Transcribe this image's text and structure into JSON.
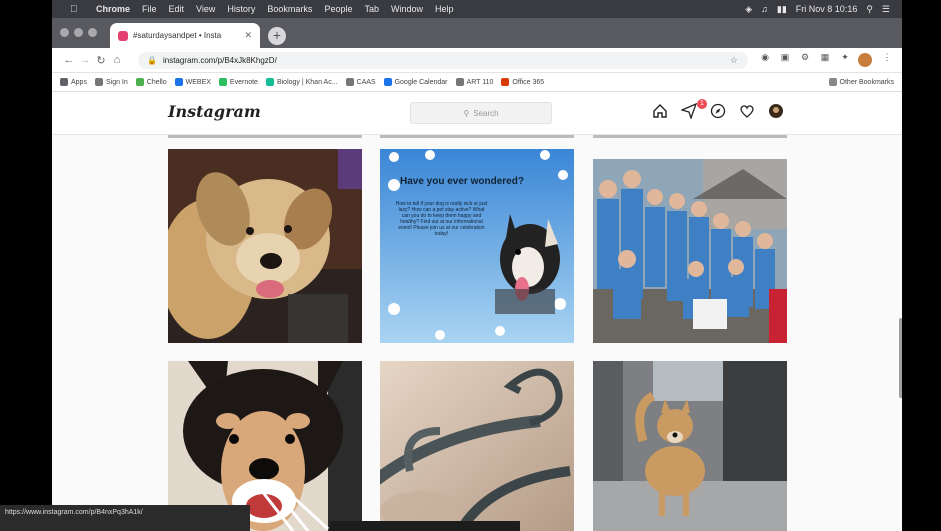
{
  "menubar": {
    "app": "Chrome",
    "items": [
      "File",
      "Edit",
      "View",
      "History",
      "Bookmarks",
      "People",
      "Tab",
      "Window",
      "Help"
    ],
    "clock": "Fri Nov 8 10:16"
  },
  "tab": {
    "title": "#saturdaysandpet • Insta"
  },
  "address": {
    "url": "instagram.com/p/B4xJk8KhgzD/"
  },
  "bookmarks": [
    {
      "label": "Apps",
      "color": "#5f6368"
    },
    {
      "label": "Sign In",
      "color": "#777777"
    },
    {
      "label": "Chello",
      "color": "#4caf50"
    },
    {
      "label": "WEBEX",
      "color": "#1a73e8"
    },
    {
      "label": "Evernote",
      "color": "#2dbe60"
    },
    {
      "label": "Biology | Khan Ac...",
      "color": "#14bf96"
    },
    {
      "label": "CAAS",
      "color": "#777777"
    },
    {
      "label": "Google Calendar",
      "color": "#1a73e8"
    },
    {
      "label": "ART 110",
      "color": "#777777"
    },
    {
      "label": "Office 365",
      "color": "#d83b01"
    }
  ],
  "bookmarks_other": "Other Bookmarks",
  "instagram": {
    "logo": "Instagram",
    "search_placeholder": "Search",
    "dm_badge": "1"
  },
  "posts": [
    {
      "name": "golden-dog-photo"
    },
    {
      "name": "have-you-ever-wondered-card",
      "title": "Have you ever wondered?",
      "body": "How to tell if your dog is really sick or just lazy? How can a pet stay active? What can you do to keep them happy and healthy? Find out at our informational event! Please join us at our celebration today!"
    },
    {
      "name": "vet-team-group-photo"
    },
    {
      "name": "husky-dog-photo"
    },
    {
      "name": "fishing-hook-photo"
    },
    {
      "name": "shiba-dog-photo"
    }
  ],
  "status_link": "https://www.instagram.com/p/B4nxPq3hA1k/"
}
